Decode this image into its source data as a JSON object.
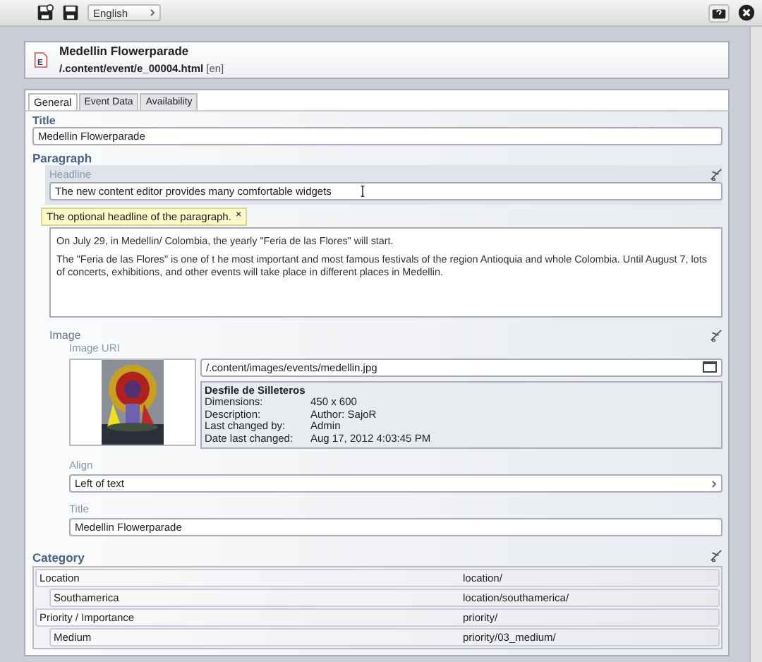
{
  "toolbar": {
    "language": "English"
  },
  "header": {
    "icon_letter": "E",
    "title": "Medellin Flowerparade",
    "path": "/.content/event/e_00004.html",
    "locale": "[en]"
  },
  "tabs": [
    {
      "label": "General",
      "selected": true
    },
    {
      "label": "Event Data",
      "selected": false
    },
    {
      "label": "Availability",
      "selected": false
    }
  ],
  "title_field": {
    "label": "Title",
    "value": "Medellin Flowerparade"
  },
  "paragraph": {
    "label": "Paragraph",
    "headline_label": "Headline",
    "headline_value": "The new content editor provides many comfortable widgets",
    "tooltip": "The optional headline of the paragraph.",
    "tooltip_close": "×",
    "text": [
      "On July 29, in Medellin/ Colombia, the yearly \"Feria de las Flores\" will start.",
      "The \"Feria de las Flores\" is one of t he most important and most famous festivals of the region Antioquia and whole Colombia. Until August 7, lots of concerts, exhibitions, and other events will take place in different places in Medellin."
    ]
  },
  "image": {
    "label": "Image",
    "uri_label": "Image URI",
    "uri": "/.content/images/events/medellin.jpg",
    "info_title": "Desfile de Silleteros",
    "info": [
      {
        "key": "Dimensions:",
        "value": "450 x 600"
      },
      {
        "key": "Description:",
        "value": "Author: SajoR"
      },
      {
        "key": "Last changed by:",
        "value": "Admin"
      },
      {
        "key": "Date last changed:",
        "value": "Aug 17, 2012 4:03:45 PM"
      }
    ],
    "align_label": "Align",
    "align": "Left of text",
    "title_label": "Title",
    "title": "Medellin Flowerparade"
  },
  "category": {
    "label": "Category",
    "rows": [
      {
        "name": "Location",
        "path": "location/",
        "children": [
          {
            "name": "Southamerica",
            "path": "location/southamerica/"
          }
        ]
      },
      {
        "name": "Priority / Importance",
        "path": "priority/",
        "children": [
          {
            "name": "Medium",
            "path": "priority/03_medium/"
          }
        ]
      }
    ]
  }
}
